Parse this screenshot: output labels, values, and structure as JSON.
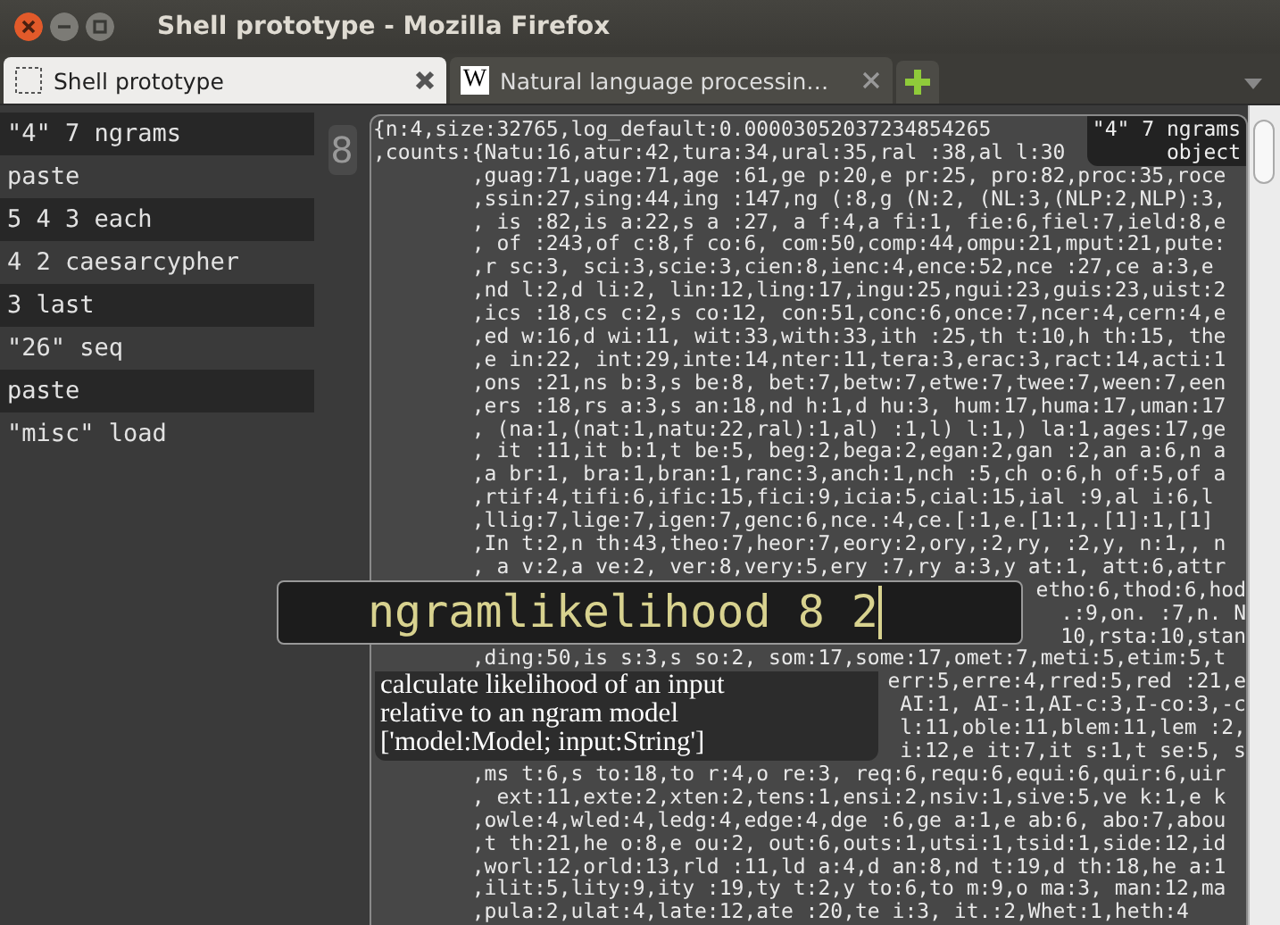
{
  "window": {
    "title": "Shell prototype - Mozilla Firefox"
  },
  "tabs": [
    {
      "label": "Shell prototype",
      "selected": true,
      "kind": "blank"
    },
    {
      "label": "Natural language processin…",
      "selected": false,
      "kind": "letter",
      "icon_text": "W"
    }
  ],
  "history": [
    {
      "text": "\"4\" 7 ngrams"
    },
    {
      "text": "paste"
    },
    {
      "text": "5 4 3 each"
    },
    {
      "text": "4 2 caesarcypher"
    },
    {
      "text": "3 last"
    },
    {
      "text": "\"26\" seq"
    },
    {
      "text": "paste"
    },
    {
      "text": "\"misc\" load"
    }
  ],
  "counter": "8",
  "output": {
    "badge": [
      "\"4\" 7 ngrams",
      "object"
    ],
    "lines": [
      {
        "kind": "first",
        "text": "{n:4,size:32765,log_default:0.00003052037234854265"
      },
      {
        "kind": "first",
        "text": ",counts:{Natu:16,atur:42,tura:34,ural:35,ral :38,al l:30"
      },
      {
        "kind": "cont",
        "text": ",guag:71,uage:71,age :61,ge p:20,e pr:25, pro:82,proc:35,roce"
      },
      {
        "kind": "cont",
        "text": ",ssin:27,sing:44,ing :147,ng (:8,g (N:2, (NL:3,(NLP:2,NLP):3,"
      },
      {
        "kind": "cont",
        "text": ", is :82,is a:22,s a :27, a f:4,a fi:1, fie:6,fiel:7,ield:8,e"
      },
      {
        "kind": "cont",
        "text": ", of :243,of c:8,f co:6, com:50,comp:44,ompu:21,mput:21,pute:"
      },
      {
        "kind": "cont",
        "text": ",r sc:3, sci:3,scie:3,cien:8,ienc:4,ence:52,nce :27,ce a:3,e"
      },
      {
        "kind": "cont",
        "text": ",nd l:2,d li:2, lin:12,ling:17,ingu:25,ngui:23,guis:23,uist:2"
      },
      {
        "kind": "cont",
        "text": ",ics :18,cs c:2,s co:12, con:51,conc:6,once:7,ncer:4,cern:4,e"
      },
      {
        "kind": "cont",
        "text": ",ed w:16,d wi:11, wit:33,with:33,ith :25,th t:10,h th:15, the"
      },
      {
        "kind": "cont",
        "text": ",e in:22, int:29,inte:14,nter:11,tera:3,erac:3,ract:14,acti:1"
      },
      {
        "kind": "cont",
        "text": ",ons :21,ns b:3,s be:8, bet:7,betw:7,etwe:7,twee:7,ween:7,een"
      },
      {
        "kind": "cont",
        "text": ",ers :18,rs a:3,s an:18,nd h:1,d hu:3, hum:17,huma:17,uman:17"
      },
      {
        "kind": "cont",
        "text": ", (na:1,(nat:1,natu:22,ral):1,al) :1,l) l:1,) la:1,ages:17,ge"
      },
      {
        "kind": "cont",
        "text": ", it :11,it b:1,t be:5, beg:2,bega:2,egan:2,gan :2,an a:6,n a"
      },
      {
        "kind": "cont",
        "text": ",a br:1, bra:1,bran:1,ranc:3,anch:1,nch :5,ch o:6,h of:5,of a"
      },
      {
        "kind": "cont",
        "text": ",rtif:4,tifi:6,ific:15,fici:9,icia:5,cial:15,ial :9,al i:6,l"
      },
      {
        "kind": "cont",
        "text": ",llig:7,lige:7,igen:7,genc:6,nce.:4,ce.[:1,e.[1:1,.[1]:1,[1]"
      },
      {
        "kind": "cont",
        "text": ",In t:2,n th:43,theo:7,heor:7,eory:2,ory,:2,ry, :2,y, n:1,, n"
      },
      {
        "kind": "cont",
        "text": ", a v:2,a ve:2, ver:8,very:5,ery :7,ry a:3,y at:1, att:6,attr"
      },
      {
        "kind": "fragment",
        "text": "etho:6,thod:6,hod"
      },
      {
        "kind": "fragment",
        "text": ".:9,on. :7,n. N"
      },
      {
        "kind": "fragment",
        "text": "10,rsta:10,stan"
      },
      {
        "kind": "cont",
        "text": ",ding:50,is s:3,s so:2, som:17,some:17,omet:7,meti:5,etim:5,t"
      },
      {
        "kind": "fragment",
        "text": "err:5,erre:4,rred:5,red :21,e"
      },
      {
        "kind": "fragment",
        "text": "AI:1, AI-:1,AI-c:3,I-co:3,-c"
      },
      {
        "kind": "fragment",
        "text": "l:11,oble:11,blem:11,lem :2,"
      },
      {
        "kind": "fragment",
        "text": "i:12,e it:7,it s:1,t se:5, s"
      },
      {
        "kind": "cont",
        "text": ",ms t:6,s to:18,to r:4,o re:3, req:6,requ:6,equi:6,quir:6,uir"
      },
      {
        "kind": "cont",
        "text": ", ext:11,exte:2,xten:2,tens:1,ensi:2,nsiv:1,sive:5,ve k:1,e k"
      },
      {
        "kind": "cont",
        "text": ",owle:4,wled:4,ledg:4,edge:4,dge :6,ge a:1,e ab:6, abo:7,abou"
      },
      {
        "kind": "cont",
        "text": ",t th:21,he o:8,e ou:2, out:6,outs:1,utsi:1,tsid:1,side:12,id"
      },
      {
        "kind": "cont",
        "text": ",worl:12,orld:13,rld :11,ld a:4,d an:8,nd t:19,d th:18,he a:1"
      },
      {
        "kind": "cont",
        "text": ",ilit:5,lity:9,ity :19,ty t:2,y to:6,to m:9,o ma:3, man:12,ma"
      },
      {
        "kind": "cont",
        "text": ",pula:2,ulat:4,late:12,ate :20,te i:3, it.:2,Whet:1,heth:4"
      }
    ]
  },
  "command": {
    "value": "ngramlikelihood 8 2"
  },
  "tooltip": {
    "lines": [
      "calculate likelihood of an input",
      "relative to an ngram model",
      "['model:Model; input:String']"
    ]
  }
}
